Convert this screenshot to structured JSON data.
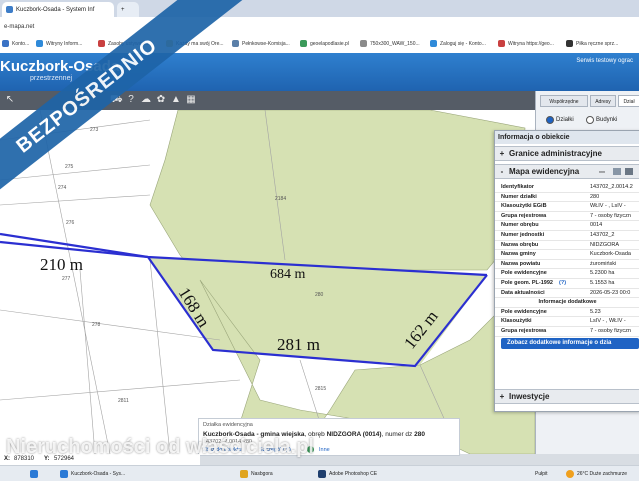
{
  "browser": {
    "tabs": [
      {
        "label": "Kuczbork-Osada - System Inf"
      },
      {
        "label": ""
      }
    ],
    "url": "e-mapa.net",
    "bookmarks": [
      {
        "label": "Konto..."
      },
      {
        "label": "Witryny Inform..."
      },
      {
        "label": "Zasoby ustywania..."
      },
      {
        "label": "Każdy ma swój Ore..."
      },
      {
        "label": "Pełnkowse-Komisja..."
      },
      {
        "label": "geoelapodlasie.pl"
      },
      {
        "label": "750x300_WAW_150..."
      },
      {
        "label": "Zaloguj się - Konto..."
      },
      {
        "label": "Witryna https://geo..."
      },
      {
        "label": "Piłka ręczne sprz..."
      }
    ]
  },
  "app": {
    "title": "Kuczbork-Osada",
    "subtitle": "przestrzennej",
    "test_env": "Serwis testowy ograc"
  },
  "right_panel": {
    "tabs": [
      "Współrzędne",
      "Adresy",
      "Dział"
    ],
    "radios": [
      {
        "label": "Działki",
        "checked": true
      },
      {
        "label": "Budynki",
        "checked": false
      }
    ]
  },
  "info_panel": {
    "title": "Informacja o obiekcie",
    "sections": {
      "admin": {
        "symbol": "+",
        "label": "Granice administracyjne"
      },
      "mapa": {
        "symbol": "-",
        "label": "Mapa ewidencyjna",
        "icon_text": "xxx"
      },
      "inwestycje": {
        "symbol": "+",
        "label": "Inwestycje"
      }
    },
    "rows": [
      {
        "k": "Identyfikator",
        "v": "143702_2.0014.2"
      },
      {
        "k": "Numer działki",
        "v": "280"
      },
      {
        "k": "Klasoużytki EGiB",
        "v": "WŁIV - , LsIV -"
      },
      {
        "k": "Grupa rejestrowa",
        "v": "7 - osoby fizyczn"
      },
      {
        "k": "Numer obrębu",
        "v": "0014"
      },
      {
        "k": "Numer jednostki",
        "v": "143702_2"
      },
      {
        "k": "Nazwa obrębu",
        "v": "NIDZGORA"
      },
      {
        "k": "Nazwa gminy",
        "v": "Kuczbork-Osada"
      },
      {
        "k": "Nazwa powiatu",
        "v": "żuromiński"
      },
      {
        "k": "Pole ewidencyjne",
        "v": "5.2300 ha"
      },
      {
        "k": "Pole geom. PL-1992",
        "v": "5.1553 ha"
      },
      {
        "k": "Data aktualności",
        "v": "2026-05-23 00:0"
      }
    ],
    "extra_header": "Informacje dodatkowe",
    "extra_rows": [
      {
        "k": "Pole ewidencyjne",
        "v": "5.23"
      },
      {
        "k": "Klasoużytki",
        "v": "LsIV - , WŁIV -"
      },
      {
        "k": "Grupa rejestrowa",
        "v": "7 - osoby fizyczn"
      }
    ],
    "more_button": "Zobacz dodatkowe informacje o dzia"
  },
  "map": {
    "parcel_labels": [
      "273",
      "275",
      "274",
      "276",
      "277",
      "2184",
      "280",
      "278",
      "2811",
      "2815"
    ],
    "dimensions": [
      "210 m",
      "684 m",
      "168 m",
      "281 m",
      "162 m"
    ]
  },
  "parcel_popup": {
    "caption": "Działka ewidencyjna",
    "name_bold": "Kuczbork-Osada - gmina wiejska",
    "name_rest": ", obręb ",
    "obreb": "NIDZGORA (0014)",
    "numer_prefix": ", numer dz ",
    "numer": "280",
    "id_line": "143702_2.0014.280",
    "links": [
      "Zbliż do obiektu",
      "Szczegóły (f)",
      "Inne"
    ]
  },
  "status": {
    "x_label": "X:",
    "x_value": "878310",
    "y_label": "Y:",
    "y_value": "572964"
  },
  "taskbar": {
    "items": [
      "Kuczbork-Osada - Sys...",
      "Nasbgora",
      "Adobe Photoshop CE"
    ],
    "weather_left": "Pułpit",
    "weather_right": "26°C Duże zachmurze"
  },
  "overlay": {
    "ribbon": "BEZPOŚREDNIO",
    "watermark": "Nieruchomości od właściciela.pl"
  }
}
